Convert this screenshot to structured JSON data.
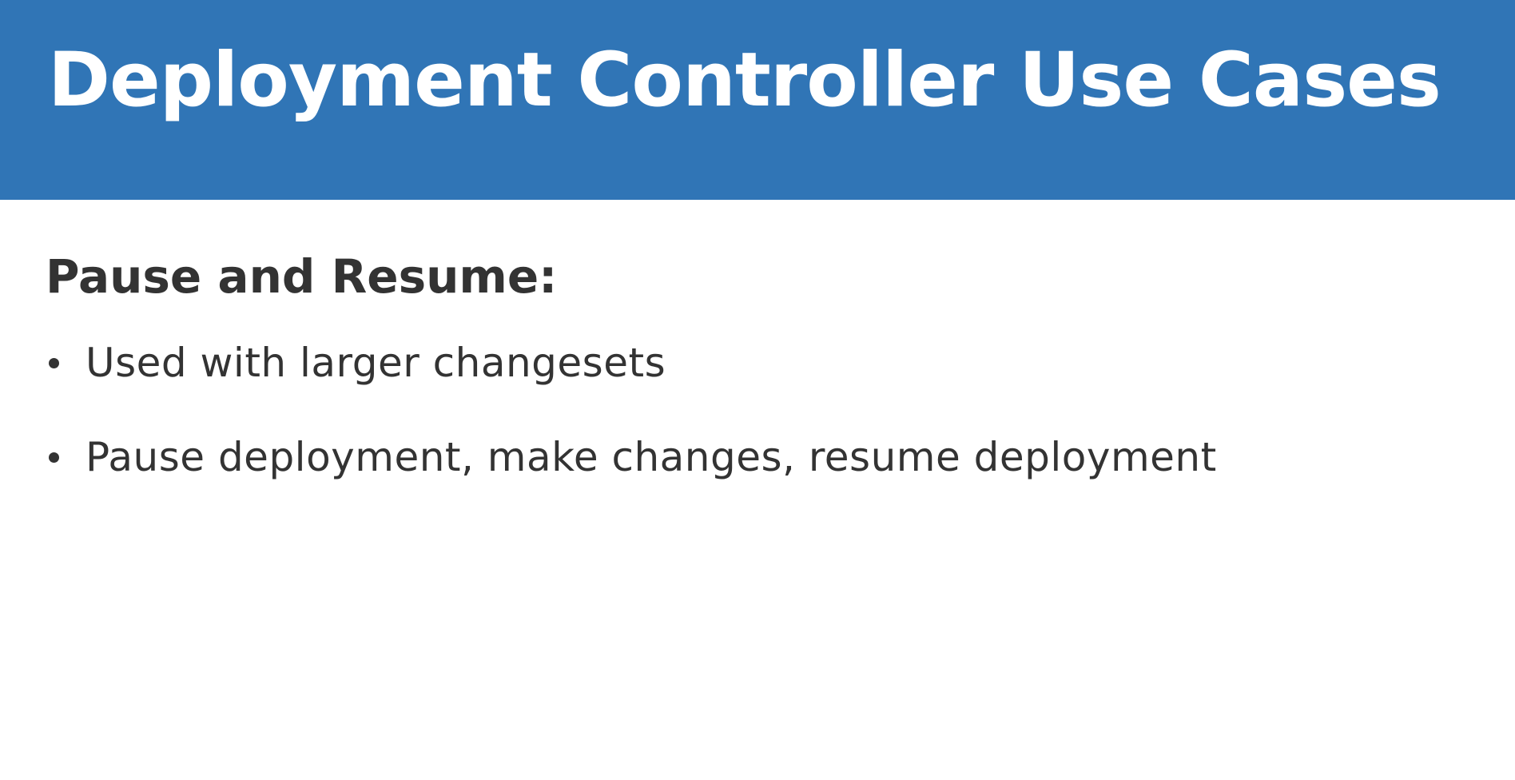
{
  "slide": {
    "title": "Deployment Controller Use Cases",
    "section_heading": "Pause and Resume:",
    "bullets": [
      "Used with larger changesets",
      "Pause deployment, make changes, resume deployment"
    ]
  },
  "colors": {
    "title_bar": "#3075b6",
    "title_text": "#ffffff",
    "body_text": "#333333",
    "background": "#ffffff"
  }
}
